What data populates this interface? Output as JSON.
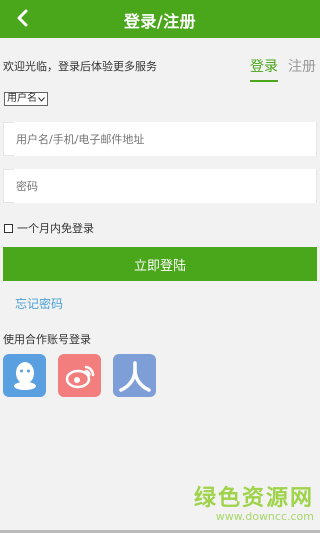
{
  "header": {
    "title": "登录/注册"
  },
  "welcome_text": "欢迎光临，登录后体验更多服务",
  "tabs": {
    "login": "登录",
    "register": "注册"
  },
  "account_type": {
    "selected": "用户名"
  },
  "fields": {
    "username_placeholder": "用户名/手机/电子邮件地址",
    "password_placeholder": "密码"
  },
  "remember_label": "一个月内免登录",
  "login_button": "立即登陆",
  "forgot_password": "忘记密码",
  "partner_login_title": "使用合作账号登录",
  "social": [
    {
      "name": "qq-icon"
    },
    {
      "name": "weibo-icon"
    },
    {
      "name": "renren-icon"
    }
  ],
  "watermark": {
    "main": "绿色资源网",
    "url": "www.downcc.com"
  },
  "colors": {
    "accent": "#4aa61a",
    "link": "#4aa0d8"
  }
}
